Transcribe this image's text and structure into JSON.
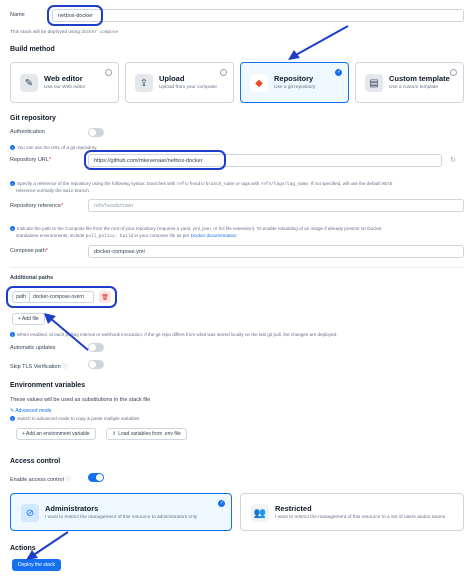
{
  "name": {
    "label": "Name",
    "value": "netbox-docker",
    "hint_prefix": "This stack will be deployed using",
    "hint_code": "docker compose"
  },
  "build_method": {
    "heading": "Build method",
    "options": [
      {
        "title": "Web editor",
        "subtitle": "Use our Web editor",
        "icon": "edit-icon",
        "selected": false
      },
      {
        "title": "Upload",
        "subtitle": "Upload from your computer",
        "icon": "upload-icon",
        "selected": false
      },
      {
        "title": "Repository",
        "subtitle": "Use a git repository",
        "icon": "git-icon",
        "selected": true
      },
      {
        "title": "Custom template",
        "subtitle": "Use a custom template",
        "icon": "template-icon",
        "selected": false
      }
    ]
  },
  "git": {
    "heading": "Git repository",
    "auth_label": "Authentication",
    "auth_info": "You can use the URL of a git repository.",
    "url_label": "Repository URL",
    "url_value": "https://github.com/mkevenaar/netbox-docker",
    "ref_info_1": "Specify a reference of the repository using the following syntax: branches with",
    "ref_code_1": "refs/heads/branch_name",
    "ref_info_2": "or tags with",
    "ref_code_2": "refs/tags/tag_name",
    "ref_info_3": ". If not specified, will use the default",
    "ref_code_3": "HEAD",
    "ref_info_4": "reference normally the",
    "ref_code_4": "main",
    "ref_info_5": "branch.",
    "ref_label": "Repository reference",
    "ref_placeholder": "refs/heads/main",
    "path_info_1": "Indicate the path to the Compose file from the root of your repository (requires a yaml, yml, json, or hcl file extension).  To enable rebuilding of an image if already present on Docker",
    "path_info_2": "standalone environments, include",
    "path_code": "pull_policy: build",
    "path_info_3": "in your compose file as per",
    "path_link": "Docker documentation",
    "compose_label": "Compose path",
    "compose_value": "docker-compose.yml",
    "additional_heading": "Additional paths",
    "additional_tag": "path",
    "additional_value": "docker-compose.overri",
    "add_file": "+ Add file",
    "polling_info": "When enabled, at each polling interval or webhook invocation, if the git repo differs from what was stored locally on the last git pull, the changes are deployed.",
    "auto_updates": "Automatic updates",
    "skip_tls": "Skip TLS Verification"
  },
  "env": {
    "heading": "Environment variables",
    "desc": "These values will be used as substitutions in the stack file",
    "advanced_link": "Advanced mode",
    "advanced_hint": "Switch to advanced mode to copy & paste multiple variables",
    "add_button": "+ Add an environment variable",
    "load_button": "Load variables from .env file"
  },
  "access": {
    "heading": "Access control",
    "enable_label": "Enable access control",
    "options": [
      {
        "title": "Administrators",
        "subtitle": "I want to restrict the management of this resource to administrators only",
        "selected": true
      },
      {
        "title": "Restricted",
        "subtitle": "I want to restrict the management of this resource to a set of users and/or teams",
        "selected": false
      }
    ]
  },
  "actions": {
    "heading": "Actions",
    "deploy": "Deploy the stack"
  },
  "colors": {
    "accent": "#1570ef",
    "annotation": "#1e3ec9"
  }
}
